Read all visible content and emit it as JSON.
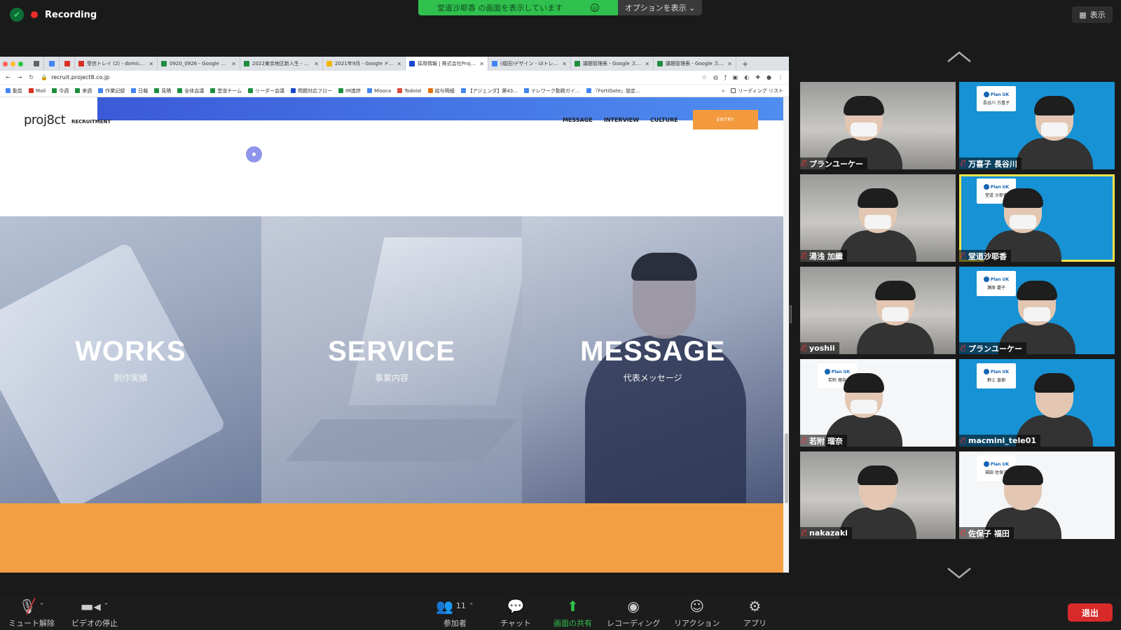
{
  "top": {
    "recording_label": "Recording",
    "share_banner_text": "堂道沙耶香 の画面を表示しています",
    "share_stop_glyph": "◎",
    "options_label": "オプションを表示",
    "view_label": "表示"
  },
  "browser": {
    "tabs": [
      {
        "text": "受信トレイ (2) - domichi...",
        "color": "#d93025"
      },
      {
        "text": "0920_0926 - Google ス...",
        "color": "#1e8e3e"
      },
      {
        "text": "2022東京地区新入生 - Go...",
        "color": "#1e8e3e"
      },
      {
        "text": "2021年9月 - Google ド...",
        "color": "#f4b400"
      },
      {
        "text": "採用情報 | 株式会社Projec...",
        "color": "#1a46c8"
      },
      {
        "text": "(福田)デザイン - UIトレン...",
        "color": "#4285f4"
      },
      {
        "text": "課題管理表 - Google スプ...",
        "color": "#1e8e3e"
      },
      {
        "text": "課題管理表 - Google スプ...",
        "color": "#1e8e3e"
      }
    ],
    "url": "recruit.project8.co.jp",
    "bookmarks": [
      {
        "text": "勤怠",
        "color": "#4285f4"
      },
      {
        "text": "Mail",
        "color": "#d93025"
      },
      {
        "text": "今週",
        "color": "#1e8e3e"
      },
      {
        "text": "来週",
        "color": "#1e8e3e"
      },
      {
        "text": "作業記録",
        "color": "#4285f4"
      },
      {
        "text": "日報",
        "color": "#4285f4"
      },
      {
        "text": "見積",
        "color": "#1e8e3e"
      },
      {
        "text": "全体会議",
        "color": "#1e8e3e"
      },
      {
        "text": "堂道チーム",
        "color": "#1e8e3e"
      },
      {
        "text": "リーダー会議",
        "color": "#1e8e3e"
      },
      {
        "text": "問題対応フロー",
        "color": "#1a46c8"
      },
      {
        "text": "IM進捗",
        "color": "#1e8e3e"
      },
      {
        "text": "Misoca",
        "color": "#4285f4"
      },
      {
        "text": "Todoist",
        "color": "#db4c3f"
      },
      {
        "text": "給与明細",
        "color": "#e8710a"
      },
      {
        "text": "【アジェンダ】第43...",
        "color": "#4285f4"
      },
      {
        "text": "テレワーク勤務ガイ...",
        "color": "#4285f4"
      },
      {
        "text": "『FortiGate』設定...",
        "color": "#4285f4"
      }
    ],
    "reading_list": "リーディング リスト",
    "site": {
      "logo": "proj8ct",
      "logo_sub": "RECRUITMENT",
      "nav": [
        "MESSAGE",
        "INTERVIEW",
        "CULTURE"
      ],
      "entry": "ENTRY",
      "panels": [
        {
          "title": "WORKS",
          "sub": "制作実績"
        },
        {
          "title": "SERVICE",
          "sub": "事業内容"
        },
        {
          "title": "MESSAGE",
          "sub": "代表メッセージ"
        }
      ]
    }
  },
  "participants": [
    {
      "name": "プランユーケー",
      "bg": "room",
      "plate": ""
    },
    {
      "name": "万喜子 長谷川",
      "bg": "blue",
      "plate": "長谷川 万喜子"
    },
    {
      "name": "湯浅 加織",
      "bg": "room",
      "plate": ""
    },
    {
      "name": "堂道沙耶香",
      "bg": "blue",
      "plate": "堂道 沙耶香",
      "active": true
    },
    {
      "name": "yoshii",
      "bg": "room",
      "plate": ""
    },
    {
      "name": "プランユーケー",
      "bg": "blue",
      "plate": "瀬原 慶子"
    },
    {
      "name": "若附 瑠奈",
      "bg": "white",
      "plate": "若附 瑠奈"
    },
    {
      "name": "macmini_tele01",
      "bg": "blue",
      "plate": "野上 直樹"
    },
    {
      "name": "nakazaki",
      "bg": "room",
      "plate": ""
    },
    {
      "name": "佐保子 福田",
      "bg": "white",
      "plate": "福田 佐保子"
    }
  ],
  "nameplate_brand": "Plan UK",
  "toolbar": {
    "mute": "ミュート解除",
    "video": "ビデオの停止",
    "participants": "参加者",
    "participants_count": "11",
    "chat": "チャット",
    "share": "画面の共有",
    "record": "レコーディング",
    "reaction": "リアクション",
    "apps": "アプリ",
    "leave": "退出"
  }
}
